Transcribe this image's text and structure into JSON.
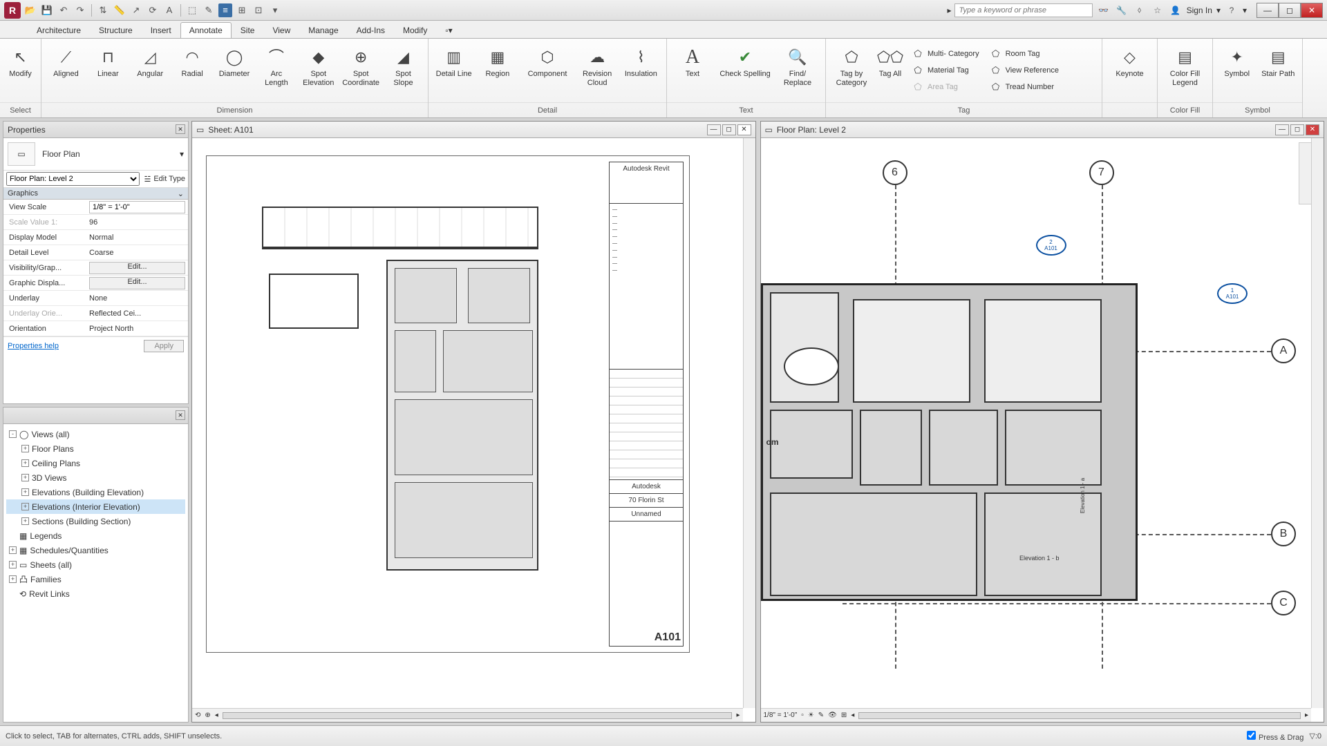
{
  "qat": {
    "search_placeholder": "Type a keyword or phrase",
    "signin": "Sign In"
  },
  "menu": {
    "tabs": [
      "Architecture",
      "Structure",
      "Insert",
      "Annotate",
      "Site",
      "View",
      "Manage",
      "Add-Ins",
      "Modify"
    ],
    "active": "Annotate"
  },
  "ribbon": {
    "select": {
      "modify": "Modify",
      "title": "Select"
    },
    "dimension": {
      "title": "Dimension",
      "btns": [
        "Aligned",
        "Linear",
        "Angular",
        "Radial",
        "Diameter",
        "Arc Length",
        "Spot Elevation",
        "Spot Coordinate",
        "Spot Slope"
      ]
    },
    "detail": {
      "title": "Detail",
      "btns": [
        "Detail Line",
        "Region",
        "Component",
        "Revision Cloud",
        "Insulation"
      ]
    },
    "text": {
      "title": "Text",
      "btns": [
        "Text",
        "Check Spelling",
        "Find/ Replace"
      ]
    },
    "tag": {
      "title": "Tag",
      "big": [
        "Tag by Category",
        "Tag All"
      ],
      "small": [
        {
          "label": "Multi- Category",
          "off": false
        },
        {
          "label": "Material  Tag",
          "off": false
        },
        {
          "label": "Area  Tag",
          "off": true
        },
        {
          "label": "Room  Tag",
          "off": false
        },
        {
          "label": "View  Reference",
          "off": false
        },
        {
          "label": "Tread  Number",
          "off": false
        }
      ]
    },
    "keynote": {
      "btn": "Keynote"
    },
    "colorfill": {
      "title": "Color Fill",
      "btn": "Color Fill Legend"
    },
    "symbol": {
      "title": "Symbol",
      "btns": [
        "Symbol",
        "Stair Path"
      ]
    }
  },
  "properties": {
    "title": "Properties",
    "family": "Floor Plan",
    "instance": "Floor Plan: Level 2",
    "edit_type": "Edit Type",
    "group": "Graphics",
    "rows": [
      {
        "k": "View Scale",
        "v": "1/8\" = 1'-0\"",
        "type": "input"
      },
      {
        "k": "Scale Value    1:",
        "v": "96",
        "type": "text",
        "dim": true
      },
      {
        "k": "Display Model",
        "v": "Normal",
        "type": "text"
      },
      {
        "k": "Detail Level",
        "v": "Coarse",
        "type": "text"
      },
      {
        "k": "Visibility/Grap...",
        "v": "Edit...",
        "type": "btn"
      },
      {
        "k": "Graphic Displa...",
        "v": "Edit...",
        "type": "btn"
      },
      {
        "k": "Underlay",
        "v": "None",
        "type": "text"
      },
      {
        "k": "Underlay Orie...",
        "v": "Reflected Cei...",
        "type": "text",
        "dim": true
      },
      {
        "k": "Orientation",
        "v": "Project North",
        "type": "text"
      }
    ],
    "help": "Properties help",
    "apply": "Apply"
  },
  "browser": {
    "items": [
      {
        "label": "Views (all)",
        "exp": "-",
        "icon": "◯"
      },
      {
        "label": "Floor Plans",
        "lvl": 1,
        "exp": "+"
      },
      {
        "label": "Ceiling Plans",
        "lvl": 1,
        "exp": "+"
      },
      {
        "label": "3D Views",
        "lvl": 1,
        "exp": "+"
      },
      {
        "label": "Elevations (Building Elevation)",
        "lvl": 1,
        "exp": "+"
      },
      {
        "label": "Elevations (Interior Elevation)",
        "lvl": 1,
        "exp": "+",
        "sel": true
      },
      {
        "label": "Sections (Building Section)",
        "lvl": 1,
        "exp": "+"
      },
      {
        "label": "Legends",
        "icon": "▦"
      },
      {
        "label": "Schedules/Quantities",
        "exp": "+",
        "icon": "▦"
      },
      {
        "label": "Sheets (all)",
        "exp": "+",
        "icon": "▭"
      },
      {
        "label": "Families",
        "exp": "+",
        "icon": "凸"
      },
      {
        "label": "Revit Links",
        "icon": "⟲"
      }
    ]
  },
  "doc1": {
    "title": "Sheet: A101",
    "titleblock_software": "Autodesk Revit",
    "titleblock_company": "Autodesk",
    "titleblock_addr": "70 Florin St",
    "titleblock_sheet": "Unnamed",
    "sheet_number": "A101"
  },
  "doc2": {
    "title": "Floor Plan: Level 2",
    "grids_top": [
      "6",
      "7"
    ],
    "grids_right": [
      "A",
      "B",
      "C"
    ],
    "callout_top": {
      "num": "2",
      "sheet": "A101"
    },
    "callout_right": {
      "num": "1",
      "sheet": "A101"
    },
    "room_label": "om",
    "elev_tag1": "Elevation 1 - a",
    "elev_tag2": "Elevation 1 - b",
    "scale": "1/8\" = 1'-0\""
  },
  "status": {
    "hint": "Click to select, TAB for alternates, CTRL adds, SHIFT unselects.",
    "pressdrag": "Press & Drag"
  }
}
